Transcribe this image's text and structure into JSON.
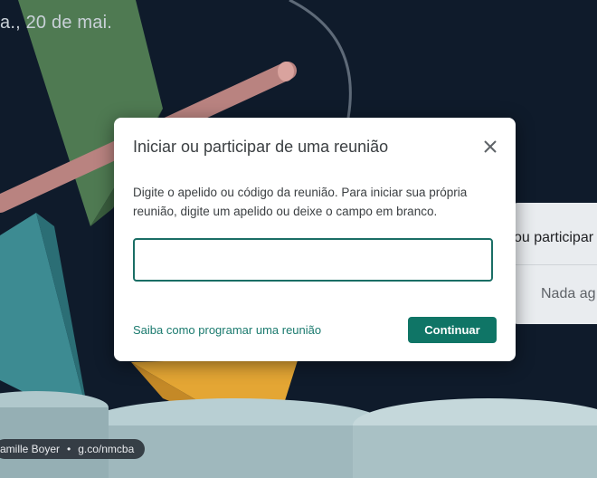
{
  "background": {
    "date_text": "a., 20 de mai.",
    "side_panel": {
      "primary_text": "ou participar",
      "secondary_text": "Nada ag"
    },
    "credit": {
      "author": "amille Boyer",
      "separator": "•",
      "link": "g.co/nmcba"
    }
  },
  "dialog": {
    "title": "Iniciar ou participar de uma reunião",
    "description": "Digite o apelido ou código da reunião. Para iniciar sua própria reunião, digite um apelido ou deixe o campo em branco.",
    "input": {
      "value": "",
      "placeholder": ""
    },
    "learn_link": "Saiba como programar uma reunião",
    "continue_label": "Continuar",
    "close_icon": "close-icon"
  },
  "colors": {
    "accent": "#0f7566",
    "link": "#1a7a6e",
    "input_border": "#1a6e65"
  }
}
